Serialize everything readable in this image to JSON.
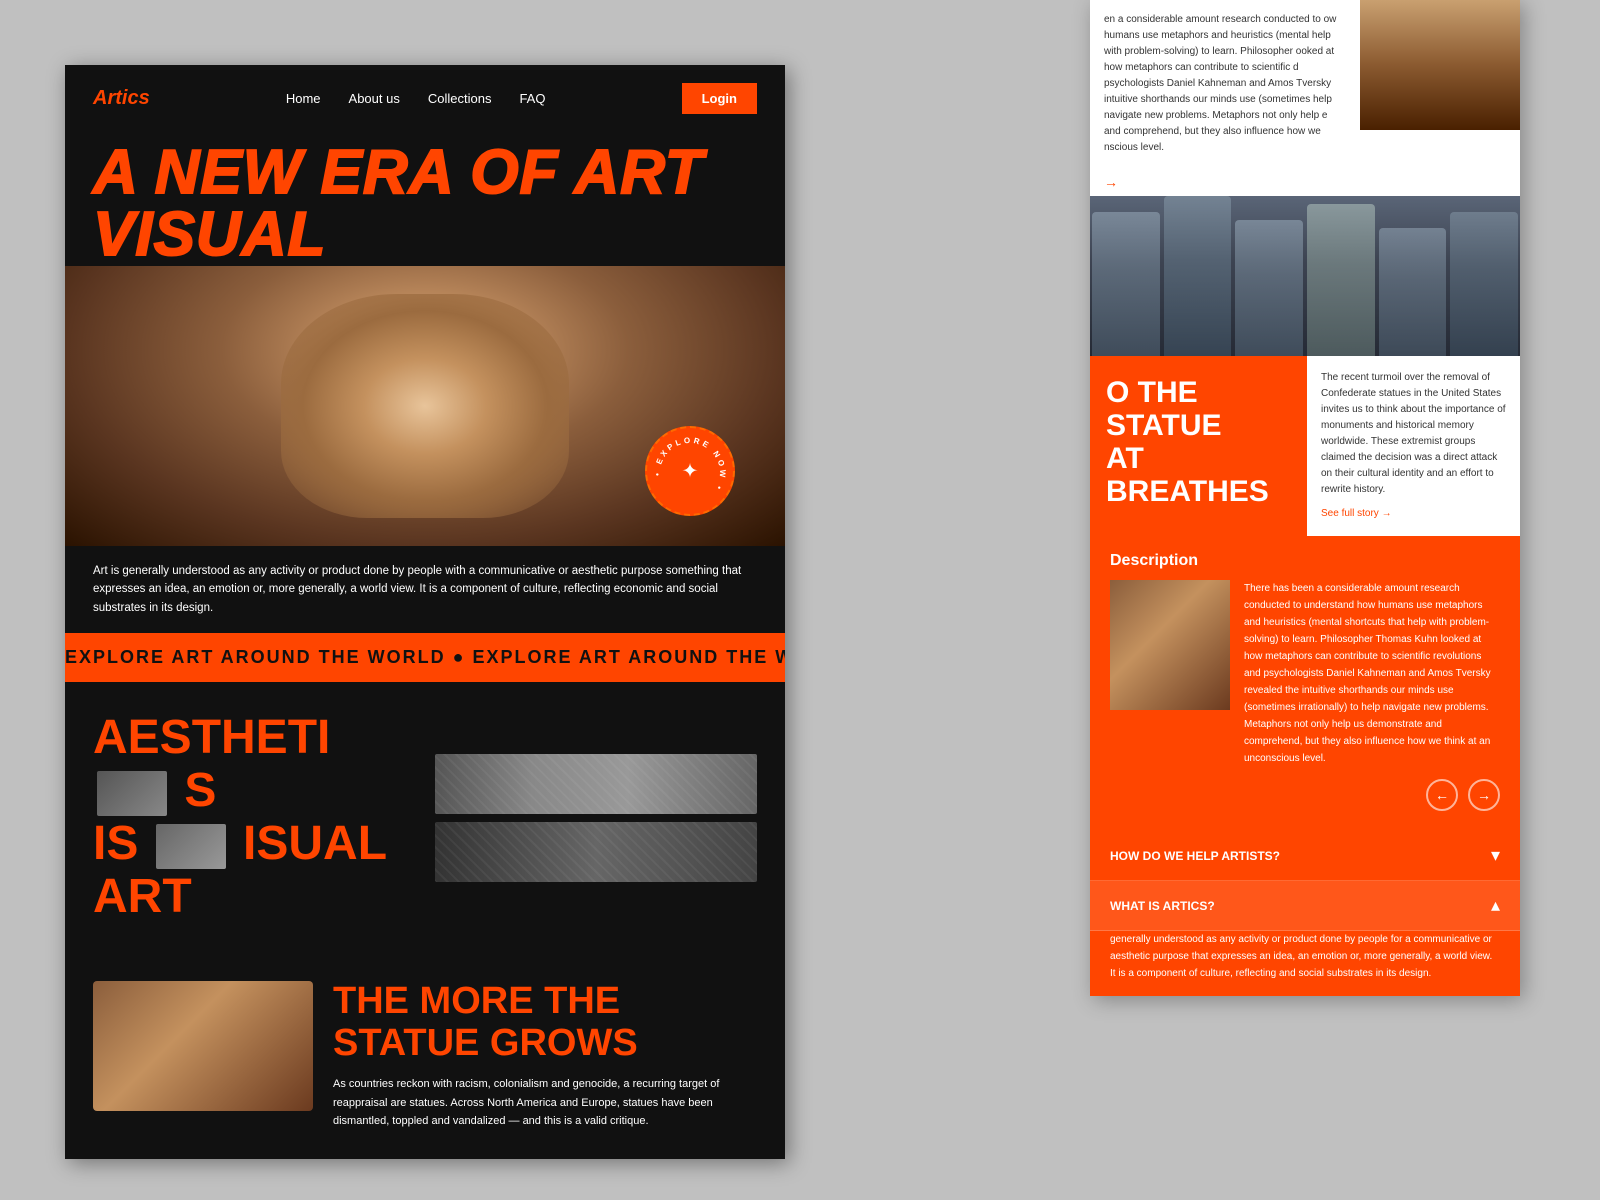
{
  "brand": {
    "logo": "Artics",
    "tagline": "A NEW ERA OF ART VISUAL"
  },
  "nav": {
    "home": "Home",
    "about": "About us",
    "collections": "Collections",
    "faq": "FAQ",
    "login": "Login"
  },
  "hero": {
    "description": "Art is generally understood as any activity or product done by people with a communicative or aesthetic purpose something that expresses an idea, an emotion or, more generally, a world view. It is a component of culture, reflecting economic and social substrates in its design.",
    "explore_badge": "EXPLORE NOW"
  },
  "marquee": {
    "text": "EXPLORE ART AROUND THE WORLD  ●  EXPLORE ART AROUND THE WORLD  ●  EXPLORE ART AROUND THE W"
  },
  "aesthetics": {
    "title_line1": "AESTHETICS",
    "title_line2": "IS VISUAL ART"
  },
  "bottom": {
    "title_line1": "THE MORE THE",
    "title_line2": "STATUE GROWS",
    "text": "As countries reckon with racism, colonialism and genocide, a recurring target of reappraisal are statues. Across North America and Europe, statues have been dismantled, toppled and vandalized — and this is a valid critique."
  },
  "right_article": {
    "top_text": "en a considerable amount research conducted to ow humans use metaphors and heuristics (mental help with problem-solving) to learn. Philosopher ooked at how metaphors can contribute to scientific d psychologists Daniel Kahneman and Amos Tversky intuitive shorthands our minds use (sometimes help navigate new problems. Metaphors not only help e and comprehend, but they also influence how we nscious level.",
    "statue_title_line1": "O THE STATUE",
    "statue_title_line2": "AT BREATHES",
    "statue_text": "The recent turmoil over the removal of Confederate statues in the United States invites us to think about the importance of monuments and historical memory worldwide. These extremist groups claimed the decision was a direct attack on their cultural identity and an effort to rewrite history.",
    "see_full": "See full story →"
  },
  "description": {
    "title": "Description",
    "text": "There has been a considerable amount research conducted to understand how humans use metaphors and heuristics (mental shortcuts that help with problem-solving) to learn. Philosopher Thomas Kuhn looked at how metaphors can contribute to scientific revolutions and psychologists Daniel Kahneman and Amos Tversky revealed the intuitive shorthands our minds use (sometimes irrationally) to help navigate new problems. Metaphors not only help us demonstrate and comprehend, but they also influence how we think at an unconscious level."
  },
  "faq": {
    "items": [
      {
        "question": "HOW DO WE HELP ARTISTS?",
        "open": false,
        "icon": "▾"
      },
      {
        "question": "WHAT IS ARTICS?",
        "open": true,
        "icon": "▴",
        "answer": "generally understood as any activity or product done by people for a communicative or aesthetic purpose that expresses an idea, an emotion or, more generally, a world view. It is a component of culture, reflecting and social substrates in its design."
      }
    ]
  },
  "colors": {
    "accent": "#ff4500",
    "dark": "#111111",
    "white": "#ffffff",
    "gray": "#c0c0c0"
  }
}
